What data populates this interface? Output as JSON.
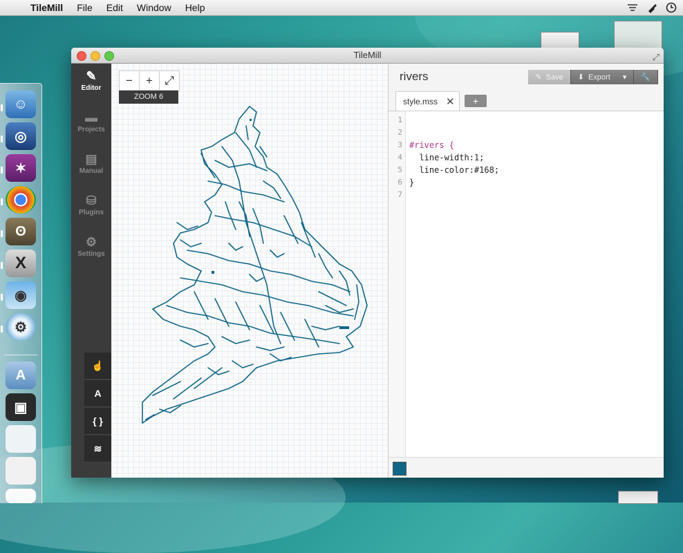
{
  "menubar": {
    "apple_glyph": "",
    "app_name": "TileMill",
    "items": [
      "File",
      "Edit",
      "Window",
      "Help"
    ]
  },
  "window": {
    "title": "TileMill",
    "sidebar": [
      {
        "label": "Editor",
        "icon": "pencil-icon",
        "active": true
      },
      {
        "label": "Projects",
        "icon": "folder-icon",
        "active": false
      },
      {
        "label": "Manual",
        "icon": "book-icon",
        "active": false
      },
      {
        "label": "Plugins",
        "icon": "plugin-icon",
        "active": false
      },
      {
        "label": "Settings",
        "icon": "gear-icon",
        "active": false
      }
    ],
    "tools": [
      {
        "name": "pan-tool",
        "glyph": "☝"
      },
      {
        "name": "font-tool",
        "glyph": "A"
      },
      {
        "name": "css-tool",
        "glyph": "{ }"
      },
      {
        "name": "layers-tool",
        "glyph": "≋"
      }
    ],
    "map": {
      "zoom_minus": "−",
      "zoom_plus": "+",
      "fullscreen": "⤢",
      "zoom_label": "ZOOM 6"
    },
    "editor": {
      "project_title": "rivers",
      "save_label": "Save",
      "export_label": "Export",
      "tab_name": "style.mss",
      "tab_close": "✕",
      "add_tab": "+",
      "lines": [
        {
          "n": "1",
          "text": ""
        },
        {
          "n": "2",
          "text": ""
        },
        {
          "n": "3",
          "text": "#rivers {"
        },
        {
          "n": "4",
          "text": "  line-width:1;"
        },
        {
          "n": "5",
          "text": "  line-color:#168;"
        },
        {
          "n": "6",
          "text": "}"
        },
        {
          "n": "7",
          "text": ""
        }
      ],
      "swatch_color": "#116688"
    }
  },
  "colors": {
    "river": "#116688",
    "sidebar_bg": "#3b3b3b"
  }
}
